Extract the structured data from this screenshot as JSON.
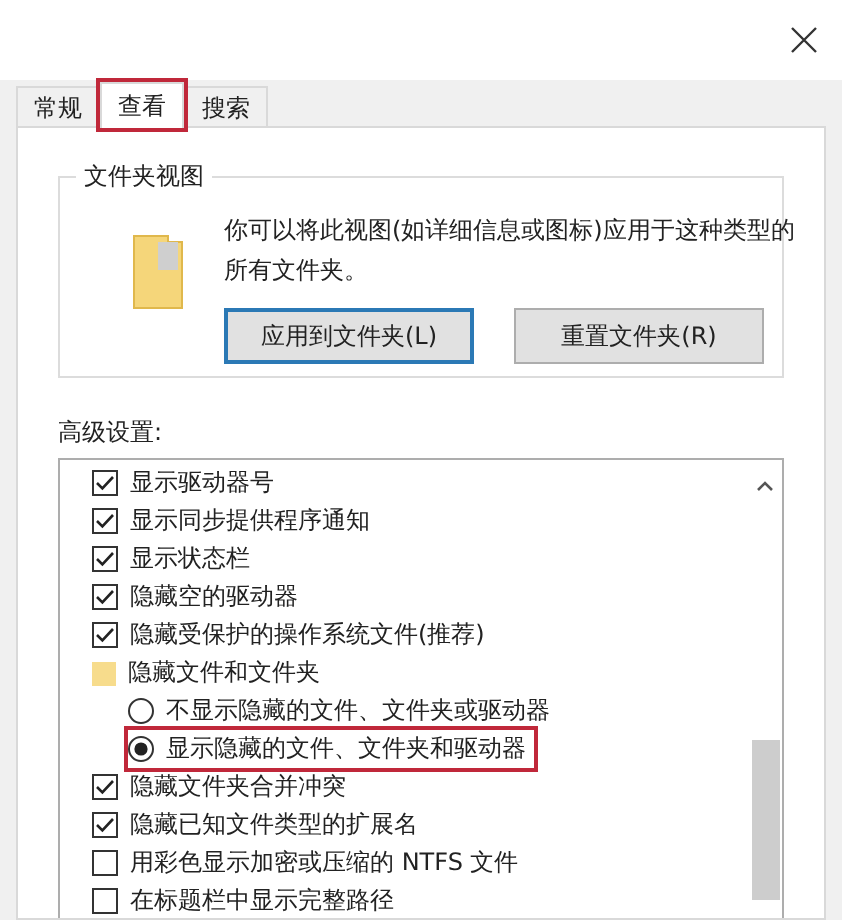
{
  "tabs": [
    {
      "label": "常规",
      "selected": false,
      "highlighted": false
    },
    {
      "label": "查看",
      "selected": true,
      "highlighted": true
    },
    {
      "label": "搜索",
      "selected": false,
      "highlighted": false
    }
  ],
  "folder_views": {
    "title": "文件夹视图",
    "description": "你可以将此视图(如详细信息或图标)应用于这种类型的所有文件夹。",
    "buttons": [
      {
        "label": "应用到文件夹(L)",
        "focused": true
      },
      {
        "label": "重置文件夹(R)",
        "focused": false
      }
    ]
  },
  "advanced": {
    "title": "高级设置:",
    "items": [
      {
        "kind": "checkbox",
        "label": "显示驱动器号",
        "checked": true
      },
      {
        "kind": "checkbox",
        "label": "显示同步提供程序通知",
        "checked": true
      },
      {
        "kind": "checkbox",
        "label": "显示状态栏",
        "checked": true
      },
      {
        "kind": "checkbox",
        "label": "隐藏空的驱动器",
        "checked": true
      },
      {
        "kind": "checkbox",
        "label": "隐藏受保护的操作系统文件(推荐)",
        "checked": true
      },
      {
        "kind": "folder",
        "label": "隐藏文件和文件夹",
        "children": [
          {
            "kind": "radio",
            "label": "不显示隐藏的文件、文件夹或驱动器",
            "selected": false,
            "highlighted": false
          },
          {
            "kind": "radio",
            "label": "显示隐藏的文件、文件夹和驱动器",
            "selected": true,
            "highlighted": true
          }
        ]
      },
      {
        "kind": "checkbox",
        "label": "隐藏文件夹合并冲突",
        "checked": true
      },
      {
        "kind": "checkbox",
        "label": "隐藏已知文件类型的扩展名",
        "checked": true
      },
      {
        "kind": "checkbox",
        "label": "用彩色显示加密或压缩的 NTFS 文件",
        "checked": false
      },
      {
        "kind": "checkbox",
        "label": "在标题栏中显示完整路径",
        "checked": false
      }
    ]
  }
}
